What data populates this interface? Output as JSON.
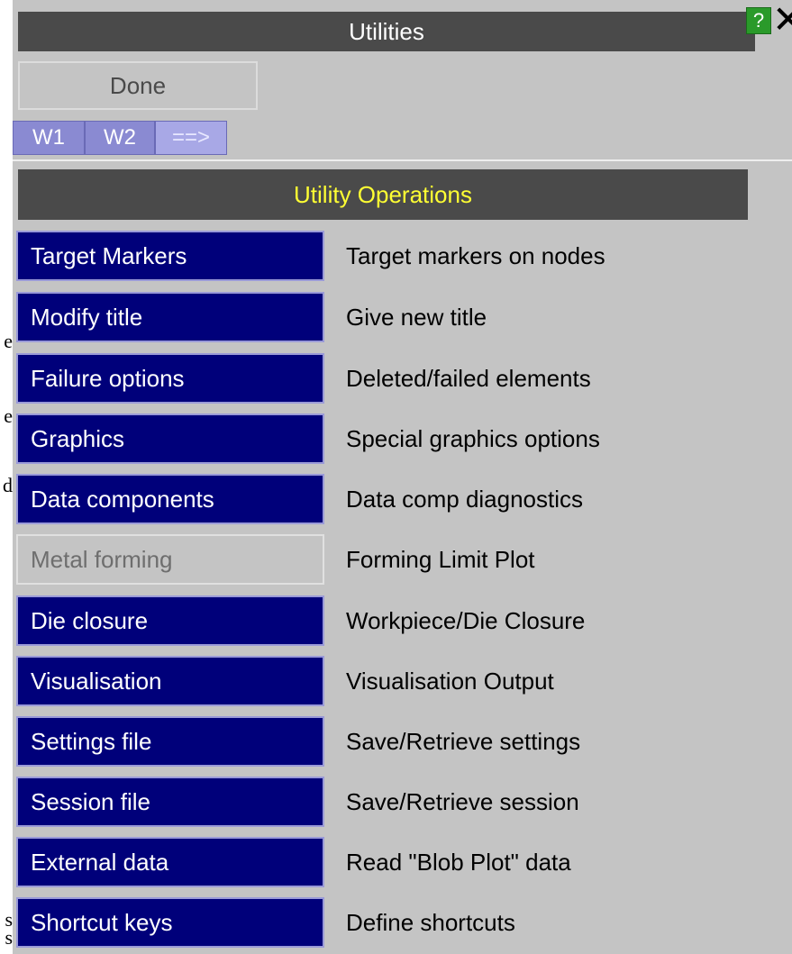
{
  "stray_fragments": [
    "e",
    "e",
    "d",
    "s",
    "s"
  ],
  "window": {
    "title": "Utilities",
    "help_label": "?",
    "close_label": "✕"
  },
  "toolbar": {
    "done_label": "Done",
    "tabs": [
      "W1",
      "W2",
      "==>"
    ]
  },
  "section": {
    "title": "Utility Operations"
  },
  "operations": [
    {
      "label": "Target Markers",
      "description": "Target markers on nodes",
      "enabled": true
    },
    {
      "label": "Modify title",
      "description": "Give new title",
      "enabled": true
    },
    {
      "label": "Failure options",
      "description": "Deleted/failed elements",
      "enabled": true
    },
    {
      "label": "Graphics",
      "description": "Special graphics options",
      "enabled": true
    },
    {
      "label": "Data components",
      "description": "Data comp diagnostics",
      "enabled": true
    },
    {
      "label": "Metal forming",
      "description": "Forming Limit Plot",
      "enabled": false
    },
    {
      "label": "Die closure",
      "description": "Workpiece/Die Closure",
      "enabled": true
    },
    {
      "label": "Visualisation",
      "description": "Visualisation Output",
      "enabled": true
    },
    {
      "label": "Settings file",
      "description": "Save/Retrieve settings",
      "enabled": true
    },
    {
      "label": "Session file",
      "description": "Save/Retrieve session",
      "enabled": true
    },
    {
      "label": "External data",
      "description": "Read \"Blob Plot\" data",
      "enabled": true
    },
    {
      "label": "Shortcut keys",
      "description": "Define shortcuts",
      "enabled": true
    }
  ]
}
